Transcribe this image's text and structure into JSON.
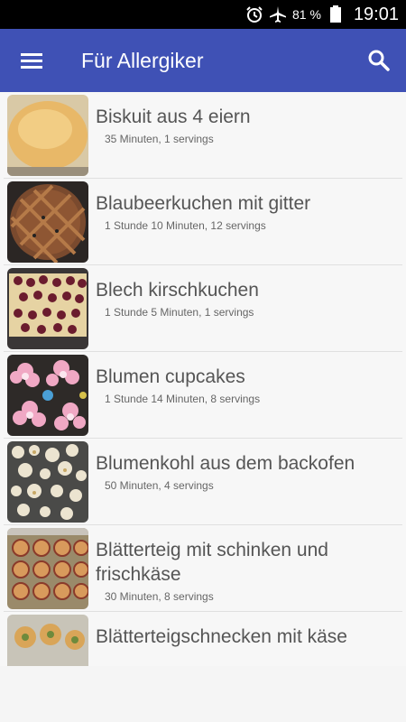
{
  "status": {
    "battery": "81 %",
    "time": "19:01"
  },
  "appbar": {
    "title": "Für Allergiker"
  },
  "recipes": [
    {
      "title": "Biskuit aus 4 eiern",
      "meta": "35 Minuten, 1 servings"
    },
    {
      "title": "Blaubeerkuchen mit gitter",
      "meta": "1 Stunde 10 Minuten, 12 servings"
    },
    {
      "title": "Blech kirschkuchen",
      "meta": "1 Stunde 5 Minuten, 1 servings"
    },
    {
      "title": "Blumen cupcakes",
      "meta": "1 Stunde 14 Minuten, 8 servings"
    },
    {
      "title": "Blumenkohl aus dem backofen",
      "meta": "50 Minuten, 4 servings"
    },
    {
      "title": "Blätterteig mit schinken und frischkäse",
      "meta": "30 Minuten, 8 servings"
    },
    {
      "title": "Blätterteigschnecken mit käse",
      "meta": ""
    }
  ],
  "colors": {
    "appbar": "#3f51b5",
    "statusbar": "#000000"
  }
}
